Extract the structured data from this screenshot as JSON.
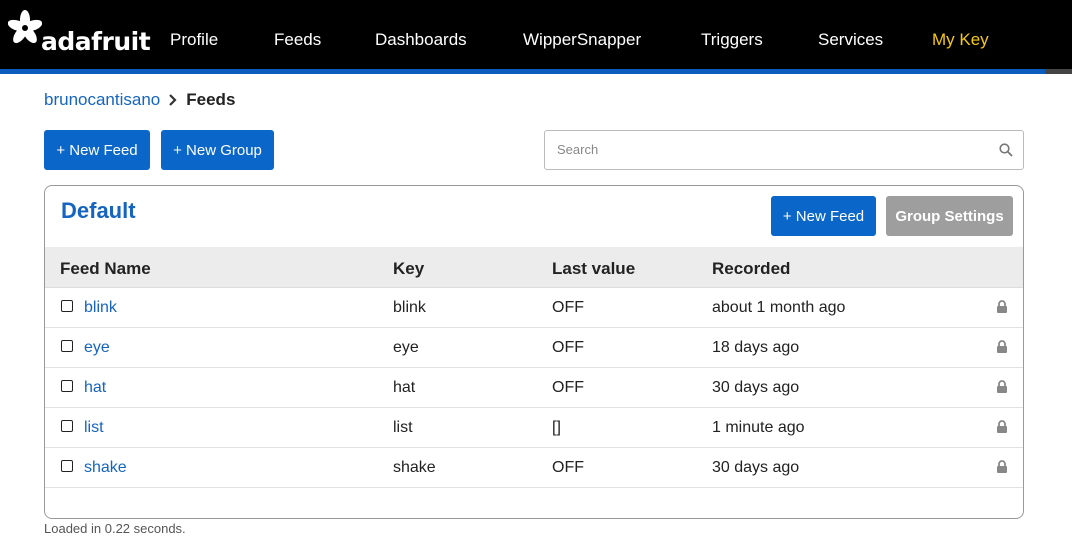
{
  "nav": {
    "logo_text": "adafruit",
    "items": [
      "Profile",
      "Feeds",
      "Dashboards",
      "WipperSnapper",
      "Triggers",
      "Services",
      "My Key"
    ]
  },
  "breadcrumb": {
    "user": "brunocantisano",
    "current": "Feeds"
  },
  "toolbar": {
    "new_feed": "+ New Feed",
    "new_group": "+ New Group",
    "search_placeholder": "Search"
  },
  "group": {
    "title": "Default",
    "new_feed": "+ New Feed",
    "settings": "Group Settings",
    "columns": [
      "Feed Name",
      "Key",
      "Last value",
      "Recorded"
    ],
    "rows": [
      {
        "name": "blink",
        "key": "blink",
        "last_value": "OFF",
        "recorded": "about 1 month ago"
      },
      {
        "name": "eye",
        "key": "eye",
        "last_value": "OFF",
        "recorded": "18 days ago"
      },
      {
        "name": "hat",
        "key": "hat",
        "last_value": "OFF",
        "recorded": "30 days ago"
      },
      {
        "name": "list",
        "key": "list",
        "last_value": "[]",
        "recorded": "1 minute ago"
      },
      {
        "name": "shake",
        "key": "shake",
        "last_value": "OFF",
        "recorded": "30 days ago"
      }
    ]
  },
  "footer": {
    "load_time": "Loaded in 0.22 seconds."
  },
  "colors": {
    "accent": "#0a66c8",
    "link": "#1565c0",
    "my_key": "#f5c816",
    "nav_bg": "#000000"
  },
  "icons": [
    "adafruit-star-logo",
    "chevron-right-icon",
    "search-icon",
    "lock-icon"
  ]
}
